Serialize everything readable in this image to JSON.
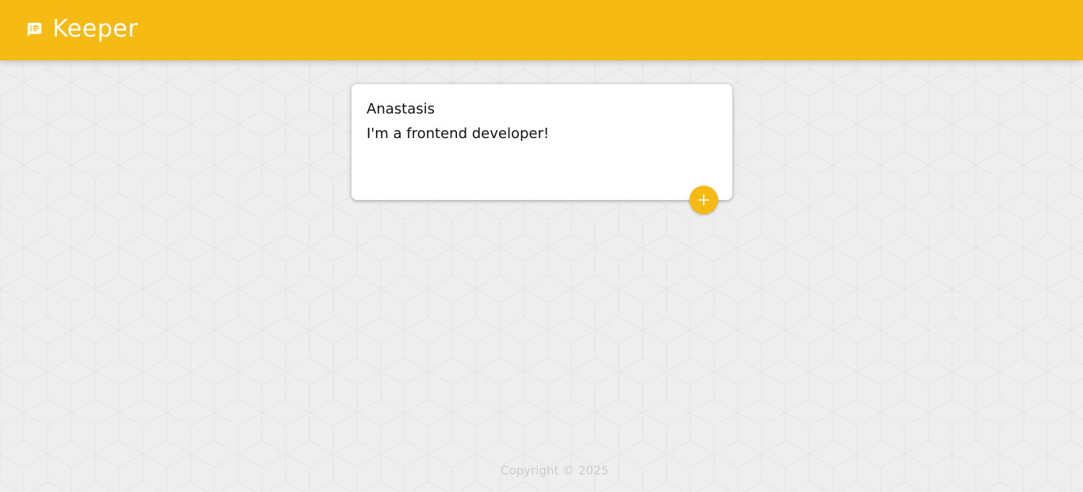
{
  "header": {
    "logo_icon": "notes-icon",
    "title": "Keeper",
    "background_color": "#f5ba13"
  },
  "create_note": {
    "title_value": "Anastasis",
    "content_value": "I'm a frontend developer!",
    "add_button_icon": "add-icon"
  },
  "footer": {
    "copyright": "Copyright © 2025"
  }
}
